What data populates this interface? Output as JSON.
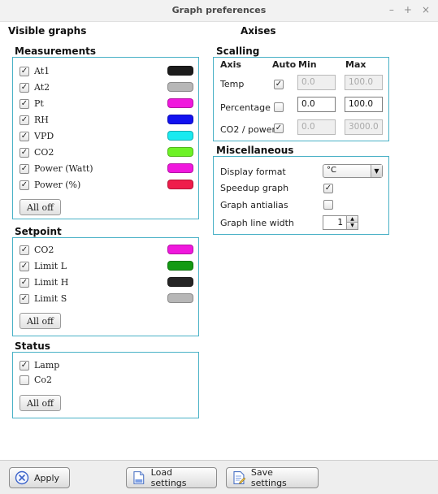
{
  "window": {
    "title": "Graph preferences",
    "controls": [
      "–",
      "+",
      "×"
    ]
  },
  "left": {
    "section_title": "Visible graphs",
    "measurements": {
      "label": "Measurements",
      "items": [
        {
          "label": "At1",
          "checked": true,
          "color": "#1c1c1c"
        },
        {
          "label": "At2",
          "checked": true,
          "color": "#b7b7b7"
        },
        {
          "label": "Pt",
          "checked": true,
          "color": "#f018dd"
        },
        {
          "label": "RH",
          "checked": true,
          "color": "#1212f0"
        },
        {
          "label": "VPD",
          "checked": true,
          "color": "#19eaf0"
        },
        {
          "label": "CO2",
          "checked": true,
          "color": "#6ef226"
        },
        {
          "label": "Power (Watt)",
          "checked": true,
          "color": "#f018dd"
        },
        {
          "label": "Power (%)",
          "checked": true,
          "color": "#ef1d4b"
        }
      ],
      "all_off": "All off"
    },
    "setpoint": {
      "label": "Setpoint",
      "items": [
        {
          "label": "CO2",
          "checked": true,
          "color": "#f018dd"
        },
        {
          "label": "Limit L",
          "checked": true,
          "color": "#139a13"
        },
        {
          "label": "Limit H",
          "checked": true,
          "color": "#252525"
        },
        {
          "label": "Limit S",
          "checked": true,
          "color": "#b7b7b7"
        }
      ],
      "all_off": "All off"
    },
    "status": {
      "label": "Status",
      "items": [
        {
          "label": "Lamp",
          "checked": true
        },
        {
          "label": "Co2",
          "checked": false
        }
      ],
      "all_off": "All off"
    }
  },
  "right": {
    "section_title": "Axises",
    "scaling": {
      "label": "Scalling",
      "headers": {
        "axis": "Axis",
        "auto": "Auto",
        "min": "Min",
        "max": "Max"
      },
      "rows": [
        {
          "axis": "Temp",
          "auto": true,
          "min": "0.0",
          "max": "100.0"
        },
        {
          "axis": "Percentage",
          "auto": false,
          "min": "0.0",
          "max": "100.0"
        },
        {
          "axis": "CO2 / power",
          "auto": true,
          "min": "0.0",
          "max": "3000.0"
        }
      ]
    },
    "misc": {
      "label": "Miscellaneous",
      "display_format_label": "Display format",
      "display_format_value": "°C",
      "speedup_label": "Speedup graph",
      "speedup_checked": true,
      "antialias_label": "Graph antialias",
      "antialias_checked": false,
      "line_width_label": "Graph line width",
      "line_width_value": "1"
    }
  },
  "footer": {
    "apply": {
      "label": "Apply",
      "icon": "x-circle-icon"
    },
    "load": {
      "label": "Load settings",
      "icon": "document-icon"
    },
    "save": {
      "label": "Save settings",
      "icon": "document-edit-icon"
    }
  },
  "colors": {
    "group_border": "#49b1c6",
    "checkmark": "✓"
  }
}
